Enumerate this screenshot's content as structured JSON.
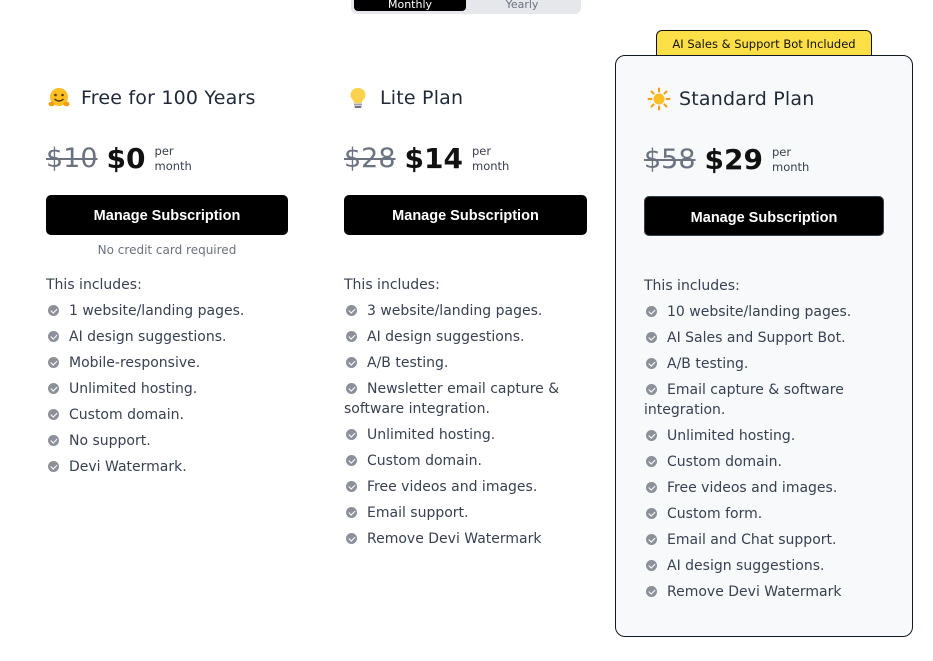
{
  "billing_toggle": {
    "options": [
      "Monthly",
      "Yearly"
    ],
    "active": "Monthly"
  },
  "plans": [
    {
      "title": "Free for 100 Years",
      "icon": "hugging-face-emoji-icon",
      "old_price": "$10",
      "price": "$0",
      "period_top": "per",
      "period_bottom": "month",
      "button": "Manage Subscription",
      "note": "No credit card required",
      "includes_label": "This includes:",
      "features": [
        "1 website/landing pages.",
        "AI design suggestions.",
        "Mobile-responsive.",
        "Unlimited hosting.",
        "Custom domain.",
        "No support.",
        "Devi Watermark."
      ]
    },
    {
      "title": "Lite Plan",
      "icon": "light-bulb-emoji-icon",
      "old_price": "$28",
      "price": "$14",
      "period_top": "per",
      "period_bottom": "month",
      "button": "Manage Subscription",
      "includes_label": "This includes:",
      "features": [
        "3 website/landing pages.",
        "AI design suggestions.",
        "A/B testing.",
        "Newsletter email capture & software integration.",
        "Unlimited hosting.",
        "Custom domain.",
        "Free videos and images.",
        "Email support.",
        "Remove Devi Watermark"
      ]
    },
    {
      "title": "Standard Plan",
      "icon": "sun-emoji-icon",
      "badge": "AI Sales & Support Bot Included",
      "old_price": "$58",
      "price": "$29",
      "period_top": "per",
      "period_bottom": "month",
      "button": "Manage Subscription",
      "includes_label": "This includes:",
      "features": [
        "10 website/landing pages.",
        "AI Sales and Support Bot.",
        "A/B testing.",
        "Email capture & software integration.",
        "Unlimited hosting.",
        "Custom domain.",
        "Free videos and images.",
        "Custom form.",
        "Email and Chat support.",
        "AI design suggestions.",
        "Remove Devi Watermark"
      ]
    }
  ]
}
